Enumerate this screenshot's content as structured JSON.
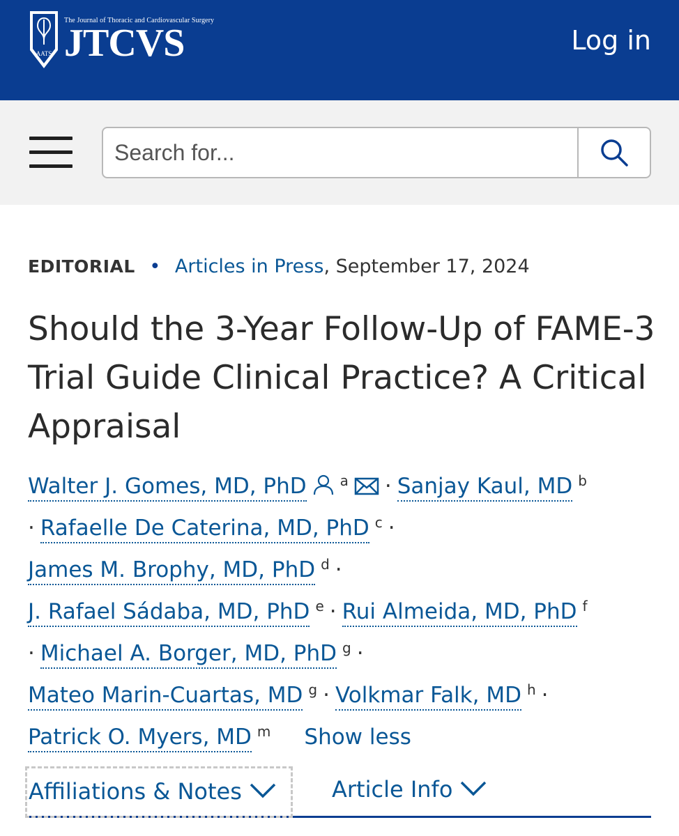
{
  "header": {
    "logo_tagline": "The Journal of Thoracic and Cardiovascular Surgery",
    "logo_text": "JTCVS",
    "logo_badge": "AATS",
    "login_label": "Log in",
    "background_color": "#0a3d91"
  },
  "search": {
    "placeholder": "Search for...",
    "menu_icon": "hamburger-menu-icon",
    "search_icon": "magnifier-icon"
  },
  "article": {
    "type": "EDITORIAL",
    "collection": "Articles in Press",
    "date": ", September 17, 2024",
    "title": "Should the 3-Year Follow-Up of FAME-3 Trial Guide Clinical Practice? A Critical Appraisal"
  },
  "authors": [
    {
      "name": "Walter J. Gomes, MD, PhD",
      "sup": "a"
    },
    {
      "name": "Sanjay Kaul, MD",
      "sup": "b"
    },
    {
      "name": "Rafaelle De Caterina, MD, PhD",
      "sup": "c"
    },
    {
      "name": "James M. Brophy, MD, PhD",
      "sup": "d"
    },
    {
      "name": "J. Rafael Sádaba, MD, PhD",
      "sup": "e"
    },
    {
      "name": "Rui Almeida, MD, PhD",
      "sup": "f"
    },
    {
      "name": "Michael A. Borger, MD, PhD",
      "sup": "g"
    },
    {
      "name": "Mateo Marin-Cuartas, MD",
      "sup": "g"
    },
    {
      "name": "Volkmar Falk, MD",
      "sup": "h"
    },
    {
      "name": "Patrick O. Myers, MD",
      "sup": "m"
    }
  ],
  "show_less_label": "Show less",
  "tabs": {
    "affiliations": "Affiliations & Notes",
    "article_info": "Article Info"
  },
  "colors": {
    "link": "#0a5796",
    "header_blue": "#0a3d91",
    "search_band": "#f2f2f2"
  }
}
